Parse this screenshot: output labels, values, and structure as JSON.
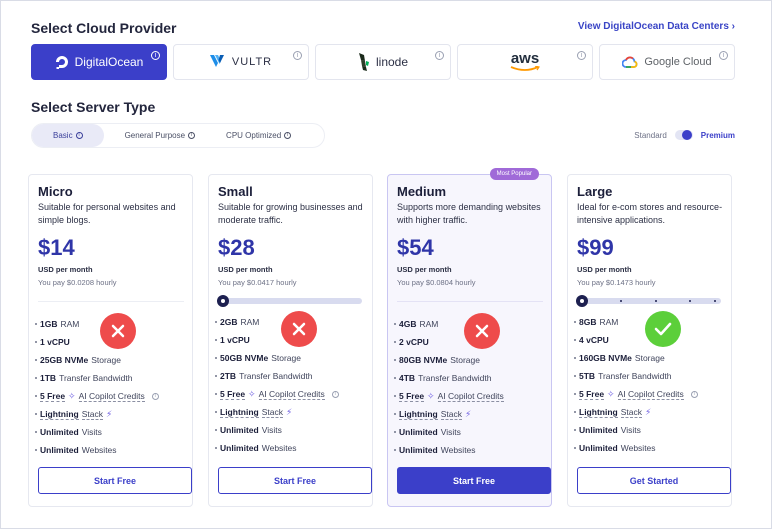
{
  "headings": {
    "provider": "Select Cloud Provider",
    "server_type": "Select Server Type",
    "data_centers_link": "View DigitalOcean Data Centers ›"
  },
  "providers": [
    {
      "label": "DigitalOcean",
      "icon": "digitalocean-logo",
      "active": true
    },
    {
      "label": "VULTR",
      "icon": "vultr-logo",
      "active": false
    },
    {
      "label": "linode",
      "icon": "linode-logo",
      "active": false
    },
    {
      "label": "aws",
      "icon": "aws-logo",
      "active": false
    },
    {
      "label": "Google Cloud",
      "icon": "google-cloud-logo",
      "active": false
    }
  ],
  "info_glyph": "i",
  "server_tabs": [
    {
      "label": "Basic",
      "active": true
    },
    {
      "label": "General Purpose",
      "active": false
    },
    {
      "label": "CPU Optimized",
      "active": false
    }
  ],
  "toggle": {
    "left": "Standard",
    "right": "Premium",
    "selected": "Premium"
  },
  "colors": {
    "accent": "#3b3fc9",
    "price": "#2f35a8",
    "popular_badge": "#a06ad8",
    "cross": "#ee4b4b",
    "check": "#5ccf3a"
  },
  "plans": [
    {
      "name": "Micro",
      "desc": "Suitable for personal websites and simple blogs.",
      "price": "$14",
      "per": "USD per month",
      "hourly": "You pay $0.0208 hourly",
      "ram": "1GB",
      "ram_suffix": "RAM",
      "cpu": "1 vCPU",
      "storage": "25GB NVMe",
      "storage_suffix": "Storage",
      "bandwidth": "1TB",
      "bandwidth_suffix": "Transfer Bandwidth",
      "status": "cross",
      "button": "Start Free"
    },
    {
      "name": "Small",
      "desc": "Suitable for growing businesses and moderate traffic.",
      "price": "$28",
      "per": "USD per month",
      "hourly": "You pay $0.0417 hourly",
      "ram": "2GB",
      "ram_suffix": "RAM",
      "cpu": "1 vCPU",
      "storage": "50GB NVMe",
      "storage_suffix": "Storage",
      "bandwidth": "2TB",
      "bandwidth_suffix": "Transfer Bandwidth",
      "status": "cross",
      "button": "Start Free"
    },
    {
      "name": "Medium",
      "badge": "Most Popular",
      "desc": "Supports more demanding websites with higher traffic.",
      "price": "$54",
      "per": "USD per month",
      "hourly": "You pay $0.0804 hourly",
      "ram": "4GB",
      "ram_suffix": "RAM",
      "cpu": "2 vCPU",
      "storage": "80GB NVMe",
      "storage_suffix": "Storage",
      "bandwidth": "4TB",
      "bandwidth_suffix": "Transfer Bandwidth",
      "status": "cross",
      "button": "Start Free"
    },
    {
      "name": "Large",
      "desc": "Ideal for e-com stores and resource-intensive applications.",
      "price": "$99",
      "per": "USD per month",
      "hourly": "You pay $0.1473 hourly",
      "ram": "8GB",
      "ram_suffix": "RAM",
      "cpu": "4 vCPU",
      "storage": "160GB NVMe",
      "storage_suffix": "Storage",
      "bandwidth": "5TB",
      "bandwidth_suffix": "Transfer Bandwidth",
      "status": "check",
      "button": "Get Started"
    }
  ],
  "shared_features": {
    "copilot_bold": "5 Free",
    "copilot_text": "AI Copilot Credits",
    "lightning_bold": "Lightning",
    "lightning_text": "Stack",
    "visits_bold": "Unlimited",
    "visits_text": "Visits",
    "websites_bold": "Unlimited",
    "websites_text": "Websites"
  }
}
